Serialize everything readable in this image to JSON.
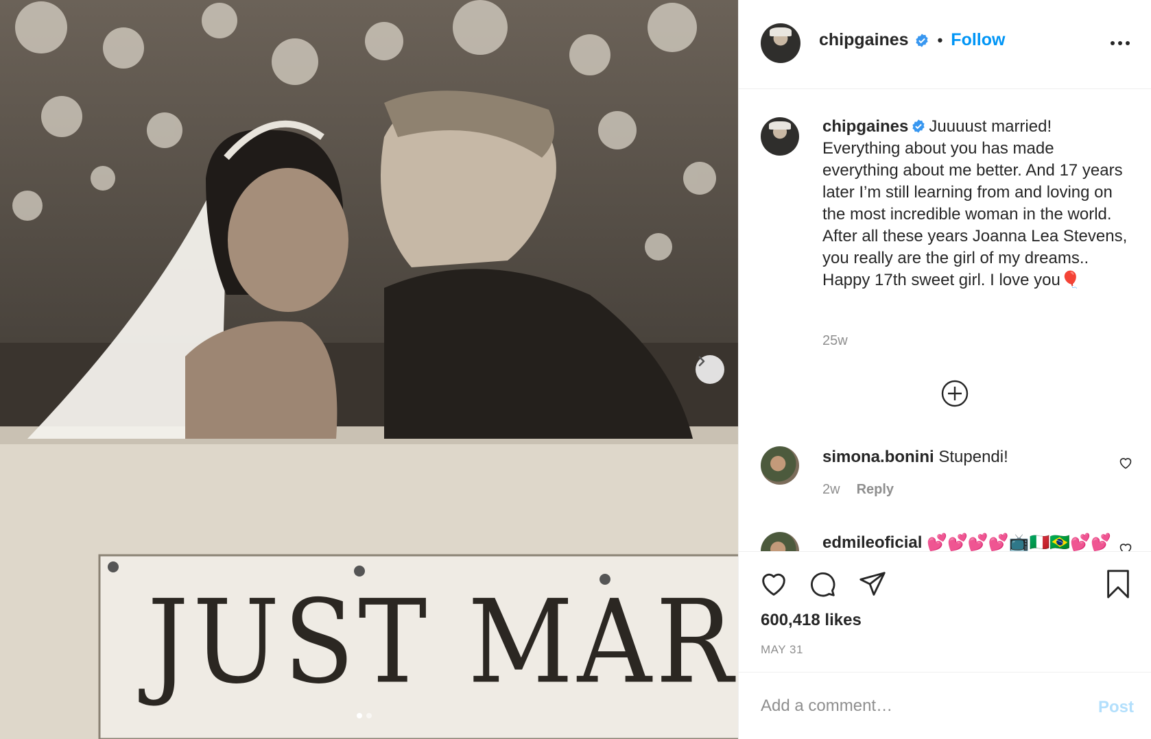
{
  "post": {
    "username": "chipgaines",
    "follow_label": "Follow",
    "separator": "•",
    "photo_sign_text": "JUST MARRIE",
    "caption_text": "Juuuust married! Everything about you has made everything about me better. And 17 years later I’m still learning from and loving on the most incredible woman in the world. After all these years Joanna Lea Stevens, you really are the girl of my dreams.. Happy 17th sweet girl. I love you🎈",
    "caption_age": "25w",
    "likes": "600,418 likes",
    "date": "MAY 31",
    "carousel": {
      "count": 2,
      "active": 1
    }
  },
  "comments": [
    {
      "username": "simona.bonini",
      "text": "Stupendi!",
      "age": "2w",
      "reply_label": "Reply"
    },
    {
      "username": "edmileoficial",
      "text": "💕💕💕💕📺🇮🇹🇧🇷💕💕",
      "age": "",
      "reply_label": ""
    }
  ],
  "comment_box": {
    "placeholder": "Add a comment…",
    "post_label": "Post"
  },
  "colors": {
    "accent": "#0095f6",
    "muted": "#8e8e8e",
    "post_disabled": "#b2dffc"
  },
  "icons": [
    "verified-badge-icon",
    "more-options-icon",
    "chevron-right-icon",
    "add-circle-icon",
    "heart-icon",
    "comment-icon",
    "share-icon",
    "bookmark-icon"
  ]
}
